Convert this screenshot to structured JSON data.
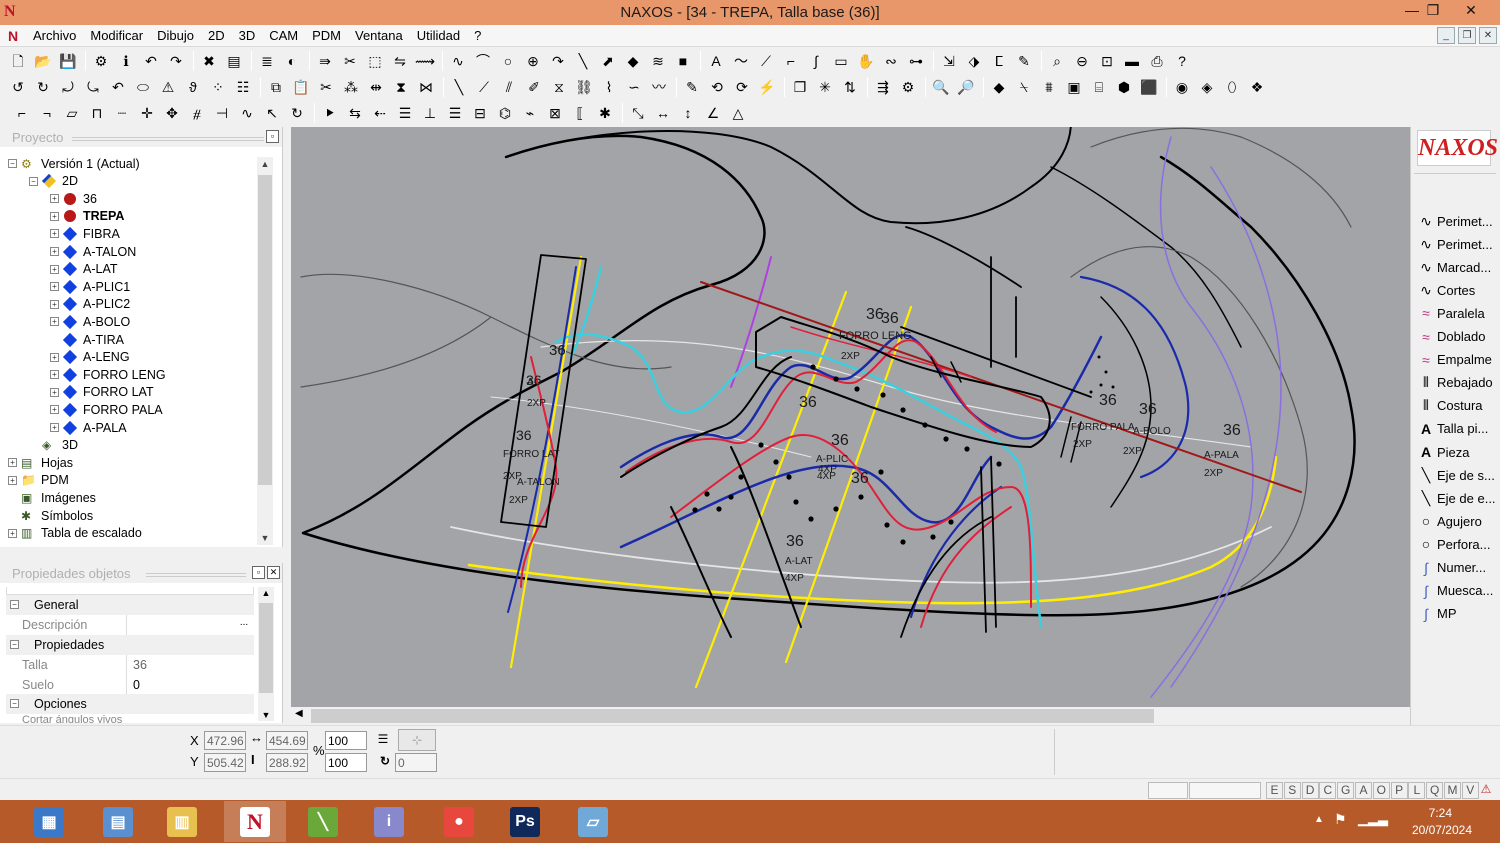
{
  "window": {
    "title": "NAXOS - [34 - TREPA, Talla base (36)]",
    "app_icon": "N",
    "minimize": "—",
    "restore": "❐",
    "close": "✕"
  },
  "menubar": {
    "items": [
      "Archivo",
      "Modificar",
      "Dibujo",
      "2D",
      "3D",
      "CAM",
      "PDM",
      "Ventana",
      "Utilidad",
      "?"
    ],
    "mdi_minimize": "_",
    "mdi_restore": "❐",
    "mdi_close": "✕"
  },
  "project_panel": {
    "title": "Proyecto",
    "tree": [
      {
        "label": "Versión 1 (Actual)",
        "icon": "gear-icon",
        "exp": "−",
        "level": 0
      },
      {
        "label": "2D",
        "icon": "2d-layer-icon",
        "exp": "−",
        "level": 1
      },
      {
        "label": "36",
        "icon": "red-circle-icon",
        "exp": "+",
        "level": 2
      },
      {
        "label": "TREPA",
        "icon": "red-circle-icon",
        "exp": "+",
        "level": 2,
        "bold": true
      },
      {
        "label": "FIBRA",
        "icon": "blue-diamond-icon",
        "exp": "+",
        "level": 2
      },
      {
        "label": "A-TALON",
        "icon": "blue-diamond-icon",
        "exp": "+",
        "level": 2
      },
      {
        "label": "A-LAT",
        "icon": "blue-diamond-icon",
        "exp": "+",
        "level": 2
      },
      {
        "label": "A-PLIC1",
        "icon": "blue-diamond-icon",
        "exp": "+",
        "level": 2
      },
      {
        "label": "A-PLIC2",
        "icon": "blue-diamond-icon",
        "exp": "+",
        "level": 2
      },
      {
        "label": "A-BOLO",
        "icon": "blue-diamond-icon",
        "exp": "+",
        "level": 2
      },
      {
        "label": "A-TIRA",
        "icon": "blue-diamond-icon",
        "exp": "",
        "level": 2
      },
      {
        "label": "A-LENG",
        "icon": "blue-diamond-icon",
        "exp": "+",
        "level": 2
      },
      {
        "label": "FORRO LENG",
        "icon": "blue-diamond-icon",
        "exp": "+",
        "level": 2
      },
      {
        "label": "FORRO LAT",
        "icon": "blue-diamond-icon",
        "exp": "+",
        "level": 2
      },
      {
        "label": "FORRO PALA",
        "icon": "blue-diamond-icon",
        "exp": "+",
        "level": 2
      },
      {
        "label": "A-PALA",
        "icon": "blue-diamond-icon",
        "exp": "+",
        "level": 2
      },
      {
        "label": "3D",
        "icon": "3d-layer-icon",
        "exp": "",
        "level": 1
      },
      {
        "label": "Hojas",
        "icon": "sheets-icon",
        "exp": "+",
        "level": 0
      },
      {
        "label": "PDM",
        "icon": "folder-icon",
        "exp": "+",
        "level": 0
      },
      {
        "label": "Imágenes",
        "icon": "images-icon",
        "exp": "",
        "level": 0
      },
      {
        "label": "Símbolos",
        "icon": "symbols-icon",
        "exp": "",
        "level": 0
      },
      {
        "label": "Tabla de escalado",
        "icon": "table-icon",
        "exp": "+",
        "level": 0
      }
    ]
  },
  "properties_panel": {
    "title": "Propiedades objetos",
    "sections": {
      "general": "General",
      "propiedades": "Propiedades",
      "opciones": "Opciones"
    },
    "rows": {
      "descripcion_label": "Descripción",
      "descripcion_value": "",
      "descripcion_btn": "...",
      "talla_label": "Talla",
      "talla_value": "36",
      "suelo_label": "Suelo",
      "suelo_value": "0",
      "cortar_label": "Cortar ángulos vivos"
    }
  },
  "canvas": {
    "background": "#a3a4a8",
    "labels": [
      {
        "text": "36"
      },
      {
        "text": "36"
      },
      {
        "text": "36"
      },
      {
        "text": "36"
      },
      {
        "text": "36"
      },
      {
        "text": "36"
      },
      {
        "text": "36"
      },
      {
        "text": "36"
      },
      {
        "text": "36"
      },
      {
        "text": "36"
      },
      {
        "text": "36"
      },
      {
        "text": "36"
      },
      {
        "text": "FORRO LENG"
      },
      {
        "text": "2XP"
      },
      {
        "text": "A-PLIC"
      },
      {
        "text": "4XP"
      },
      {
        "text": "4XP"
      },
      {
        "text": "A-LAT"
      },
      {
        "text": "4XP"
      },
      {
        "text": "FORRO PALA"
      },
      {
        "text": "2XP"
      },
      {
        "text": "A-BOLO"
      },
      {
        "text": "2XP"
      },
      {
        "text": "A-PALA"
      },
      {
        "text": "2XP"
      },
      {
        "text": "FORRO LAT"
      },
      {
        "text": "2XP"
      },
      {
        "text": "A-TALON"
      },
      {
        "text": "2XP"
      },
      {
        "text": "A-"
      },
      {
        "text": "2XP"
      }
    ]
  },
  "right_panel": {
    "logo": "NAXOS",
    "tools": [
      {
        "label": "Perimet...",
        "icon": "curve-icon"
      },
      {
        "label": "Perimet...",
        "icon": "curve-icon"
      },
      {
        "label": "Marcad...",
        "icon": "curve-icon"
      },
      {
        "label": "Cortes",
        "icon": "curve-icon"
      },
      {
        "label": "Paralela",
        "icon": "parallel-curve-icon"
      },
      {
        "label": "Doblado",
        "icon": "parallel-curve-icon"
      },
      {
        "label": "Empalme",
        "icon": "parallel-curve-icon"
      },
      {
        "label": "Rebajado",
        "icon": "stitch-icon"
      },
      {
        "label": "Costura",
        "icon": "stitch-icon"
      },
      {
        "label": "Talla pi...",
        "icon": "text-a-icon"
      },
      {
        "label": "Pieza",
        "icon": "text-a-icon"
      },
      {
        "label": "Eje de s...",
        "icon": "axis-icon"
      },
      {
        "label": "Eje de e...",
        "icon": "axis-icon"
      },
      {
        "label": "Agujero",
        "icon": "circle-icon"
      },
      {
        "label": "Perfora...",
        "icon": "circle-icon"
      },
      {
        "label": "Numer...",
        "icon": "pen-curve-icon"
      },
      {
        "label": "Muesca...",
        "icon": "pen-curve-icon"
      },
      {
        "label": "MP",
        "icon": "pen-curve-icon"
      }
    ]
  },
  "coordinates": {
    "x_label": "X",
    "y_label": "Y",
    "x_value": "472.96",
    "y_value": "505.42",
    "width_value": "454.69",
    "height_value": "288.92",
    "percent": "%",
    "scale_x": "100",
    "scale_y": "100",
    "rotation": "0"
  },
  "statusbar": {
    "letters": [
      "E",
      "S",
      "D",
      "C",
      "G",
      "A",
      "O",
      "P",
      "L",
      "Q",
      "M",
      "V"
    ]
  },
  "taskbar": {
    "apps": [
      {
        "name": "calculator",
        "color": "#3c78c8",
        "glyph": "▦"
      },
      {
        "name": "explorer-2",
        "color": "#5a8fd0",
        "glyph": "▤"
      },
      {
        "name": "file-explorer",
        "color": "#e8c050",
        "glyph": "▥"
      },
      {
        "name": "naxos",
        "color": "#ffffff",
        "glyph": "N"
      },
      {
        "name": "green-app",
        "color": "#6aa83a",
        "glyph": "╲"
      },
      {
        "name": "doc-app",
        "color": "#8888cc",
        "glyph": "i"
      },
      {
        "name": "chrome",
        "color": "#e8473e",
        "glyph": "●"
      },
      {
        "name": "photoshop",
        "color": "#0f2a5a",
        "glyph": "Ps"
      },
      {
        "name": "notes",
        "color": "#70a8d8",
        "glyph": "▱"
      }
    ],
    "time": "7:24",
    "date": "20/07/2024"
  }
}
